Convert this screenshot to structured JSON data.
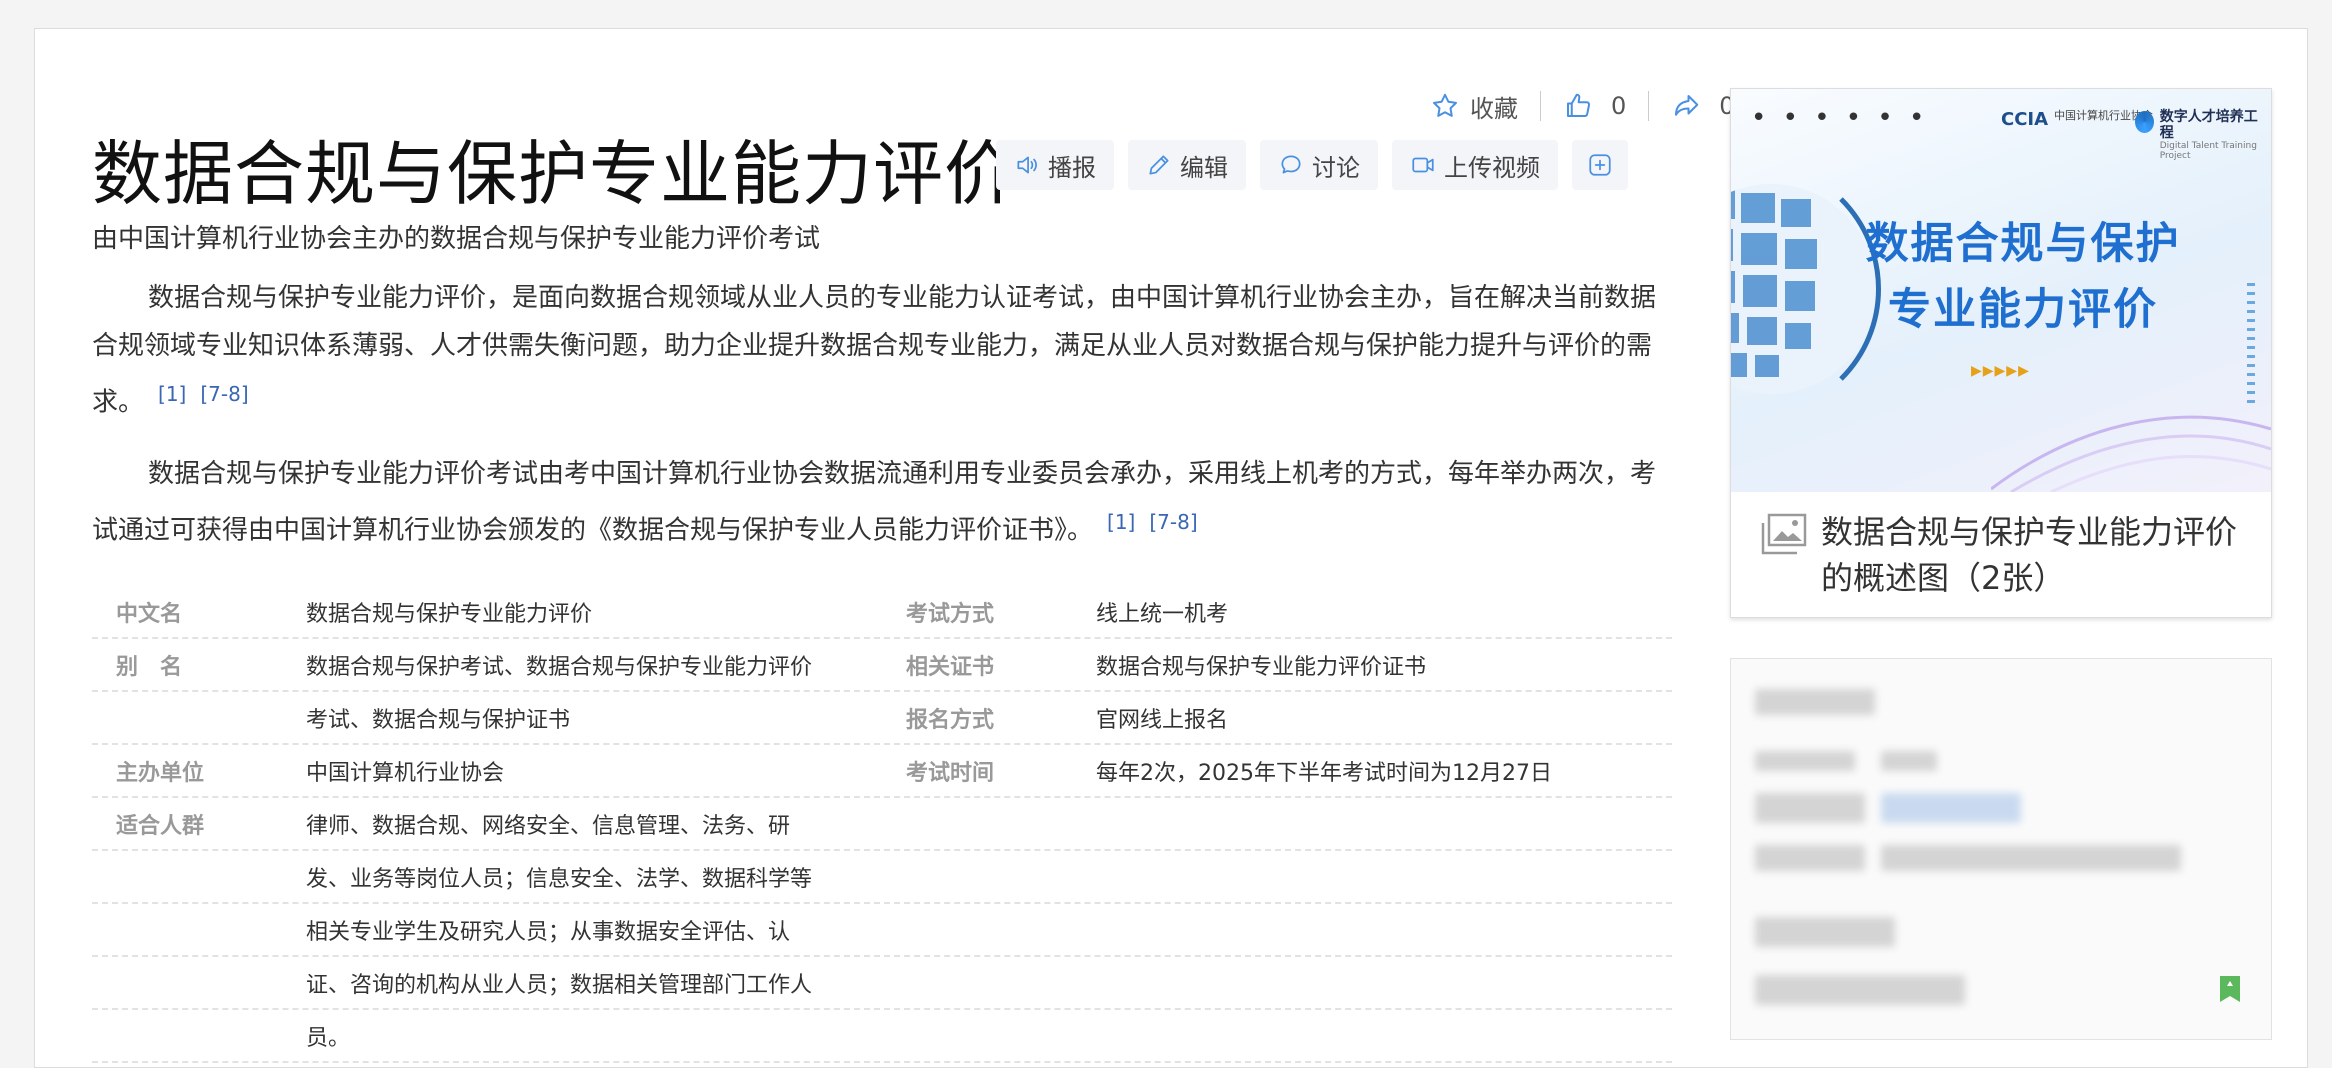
{
  "top_actions": {
    "collect": "收藏",
    "like_count": "0",
    "share_count": "0"
  },
  "title": "数据合规与保护专业能力评价",
  "toolbar": {
    "broadcast": "播报",
    "edit": "编辑",
    "discuss": "讨论",
    "upload_video": "上传视频"
  },
  "subtitle": "由中国计算机行业协会主办的数据合规与保护专业能力评价考试",
  "paragraphs": [
    {
      "text": "数据合规与保护专业能力评价，是面向数据合规领域从业人员的专业能力认证考试，由中国计算机行业协会主办，旨在解决当前数据合规领域专业知识体系薄弱、人才供需失衡问题，助力企业提升数据合规专业能力，满足从业人员对数据合规与保护能力提升与评价的需求。",
      "cite1": "[1]",
      "cite2": "[7-8]"
    },
    {
      "text": "数据合规与保护专业能力评价考试由考中国计算机行业协会数据流通利用专业委员会承办，采用线上机考的方式，每年举办两次，考试通过可获得由中国计算机行业协会颁发的《数据合规与保护专业人员能力评价证书》。",
      "cite1": "[1]",
      "cite2": "[7-8]"
    }
  ],
  "info": [
    {
      "l1": "中文名",
      "v1": "数据合规与保护专业能力评价",
      "l2": "考试方式",
      "v2": "线上统一机考"
    },
    {
      "l1": "别　名",
      "v1": "数据合规与保护考试、数据合规与保护专业能力评价",
      "l2": "相关证书",
      "v2": "数据合规与保护专业能力评价证书"
    },
    {
      "l1": "",
      "v1": "考试、数据合规与保护证书",
      "l2": "报名方式",
      "v2": "官网线上报名"
    },
    {
      "l1": "主办单位",
      "v1": "中国计算机行业协会",
      "l2": "考试时间",
      "v2": "每年2次，2025年下半年考试时间为12月27日"
    },
    {
      "l1": "适合人群",
      "v1": "律师、数据合规、网络安全、信息管理、法务、研",
      "l2": "",
      "v2": ""
    },
    {
      "l1": "",
      "v1": "发、业务等岗位人员；信息安全、法学、数据科学等",
      "l2": "",
      "v2": ""
    },
    {
      "l1": "",
      "v1": "相关专业学生及研究人员；从事数据安全评估、认",
      "l2": "",
      "v2": ""
    },
    {
      "l1": "",
      "v1": "证、咨询的机构从业人员；数据相关管理部门工作人",
      "l2": "",
      "v2": ""
    },
    {
      "l1": "",
      "v1": "员。",
      "l2": "",
      "v2": ""
    }
  ],
  "album": {
    "dots": "• • • • • •",
    "logo1_mark": "CCIA",
    "logo1_text": "中国计算机行业协会",
    "logo2_text": "数字人才培养工程",
    "logo2_sub": "Digital Talent Training Project",
    "poster_title_line1": "数据合规与保护",
    "poster_title_line2": "专业能力评价",
    "arrows": "▶▶▶▶▶",
    "caption": "数据合规与保护专业能力评价的概述图（2张）"
  },
  "icons": [
    "star-icon",
    "thumb-up-icon",
    "share-icon",
    "speaker-icon",
    "pencil-icon",
    "chat-icon",
    "video-icon",
    "plus-icon",
    "gallery-icon",
    "bookmark-icon"
  ],
  "colors": {
    "link": "#3a66b4",
    "label": "#999999",
    "accent_blue": "#1f6fd0",
    "bookmark": "#5cb85c"
  }
}
